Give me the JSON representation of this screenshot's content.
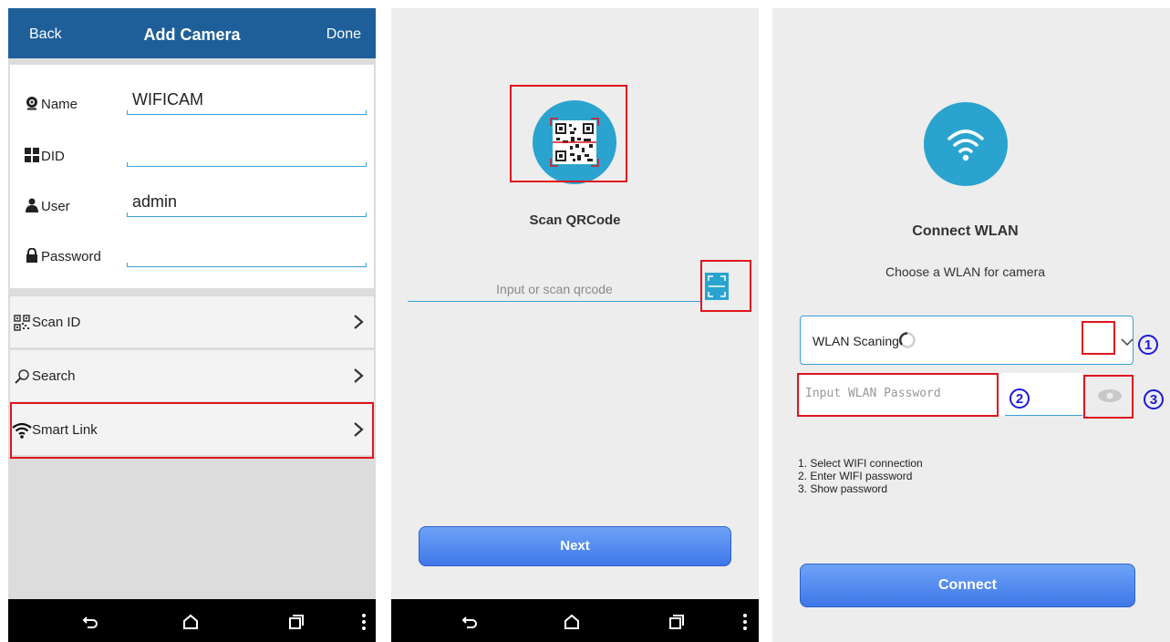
{
  "panel1": {
    "header": {
      "back_label": "Back",
      "title": "Add Camera",
      "done_label": "Done"
    },
    "fields": [
      {
        "label": "Name",
        "value": "WIFICAM",
        "icon": "camera-icon"
      },
      {
        "label": "DID",
        "value": "",
        "icon": "grid-icon"
      },
      {
        "label": "User",
        "value": "admin",
        "icon": "user-icon"
      },
      {
        "label": "Password",
        "value": "",
        "icon": "lock-icon"
      }
    ],
    "menu": [
      {
        "label": "Scan ID",
        "icon": "qrcode-icon"
      },
      {
        "label": "Search",
        "icon": "search-icon"
      },
      {
        "label": "Smart Link",
        "icon": "wifi-icon"
      }
    ]
  },
  "panel2": {
    "title": "Scan QRCode",
    "input_placeholder": "Input or scan qrcode",
    "next_label": "Next"
  },
  "panel3": {
    "title": "Connect WLAN",
    "subtitle": "Choose a WLAN for camera",
    "wlan_select_value": "WLAN Scaning",
    "password_placeholder": "Input WLAN Password",
    "markers": [
      "1",
      "2",
      "3"
    ],
    "steps": [
      "1. Select WIFI connection",
      "2. Enter WIFI password",
      "3. Show password"
    ],
    "connect_label": "Connect"
  },
  "colors": {
    "header_blue": "#1f5f99",
    "accent_teal": "#2aa4cf",
    "button_blue": "#4a82ee",
    "highlight_red": "#e0141e",
    "marker_blue": "#1a1ad8"
  }
}
